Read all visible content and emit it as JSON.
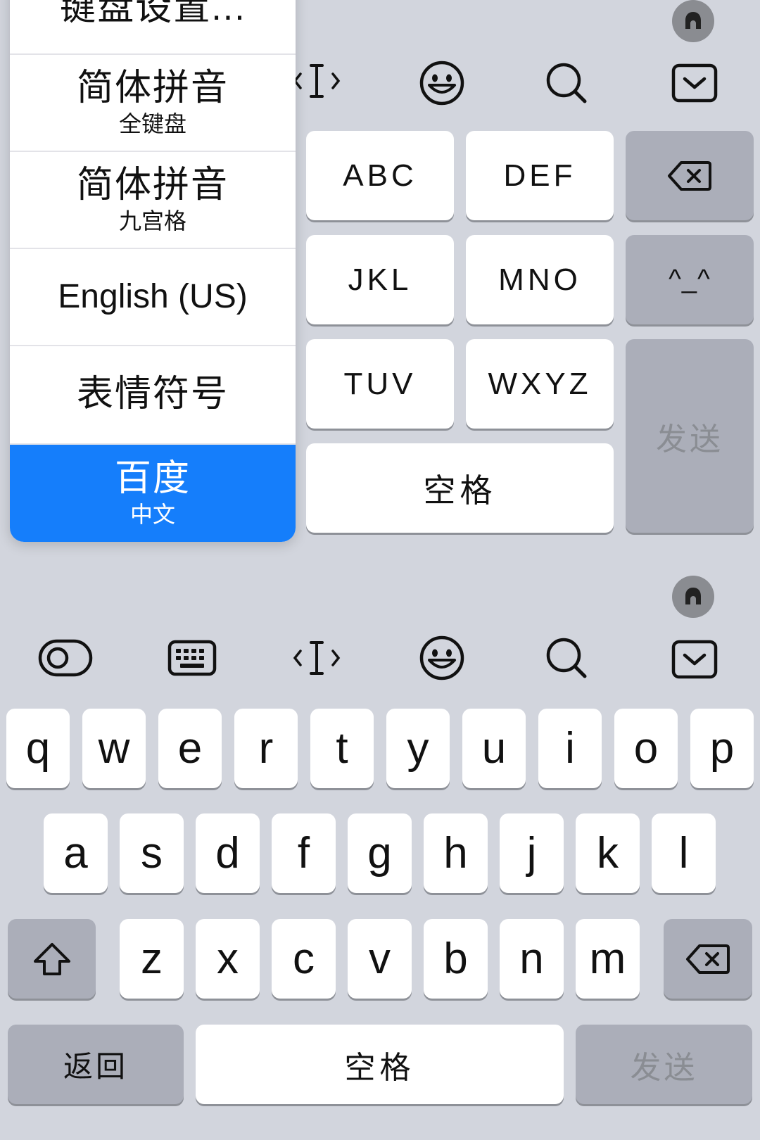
{
  "colors": {
    "keyboard_bg": "#d2d5dd",
    "key_white": "#ffffff",
    "key_gray": "#abaeb9",
    "selected_blue": "#157efb",
    "send_text": "#8a8d93"
  },
  "top_keyboard": {
    "toolbar_icons": [
      "cursor-move-icon",
      "emoji-icon",
      "search-icon",
      "hide-keyboard-icon"
    ],
    "t9_keys": [
      "ABC",
      "DEF",
      "JKL",
      "MNO",
      "TUV",
      "WXYZ"
    ],
    "space_label": "空格",
    "send_label": "发送",
    "face_label": "^_^"
  },
  "input_method_menu": {
    "items": [
      {
        "main": "键盘设置...",
        "sub": ""
      },
      {
        "main": "简体拼音",
        "sub": "全键盘"
      },
      {
        "main": "简体拼音",
        "sub": "九宫格"
      },
      {
        "main": "English (US)",
        "sub": ""
      },
      {
        "main": "表情符号",
        "sub": ""
      },
      {
        "main": "百度",
        "sub": "中文",
        "selected": true
      }
    ]
  },
  "bottom_keyboard": {
    "toolbar_icons": [
      "toggle-icon",
      "keyboard-icon",
      "cursor-move-icon",
      "emoji-icon",
      "search-icon",
      "hide-keyboard-icon"
    ],
    "row1": [
      "q",
      "w",
      "e",
      "r",
      "t",
      "y",
      "u",
      "i",
      "o",
      "p"
    ],
    "row2": [
      "a",
      "s",
      "d",
      "f",
      "g",
      "h",
      "j",
      "k",
      "l"
    ],
    "row3": [
      "z",
      "x",
      "c",
      "v",
      "b",
      "n",
      "m"
    ],
    "return_label": "返回",
    "space_label": "空格",
    "send_label": "发送"
  }
}
